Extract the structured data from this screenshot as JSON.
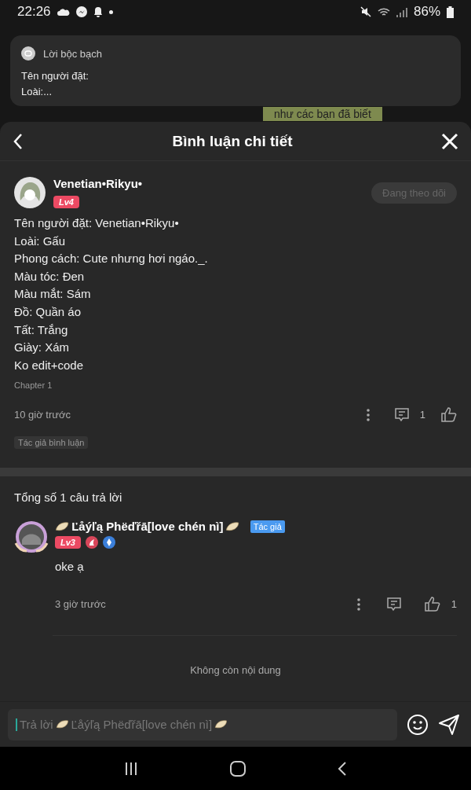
{
  "status_bar": {
    "time": "22:26",
    "battery": "86%"
  },
  "notification": {
    "app": "Lời bộc bạch",
    "lines": [
      "Tên người đặt:",
      "Loài:..."
    ]
  },
  "background_bubble": "như các bạn đã biết",
  "header": {
    "title": "Bình luận chi tiết"
  },
  "comment": {
    "author": "Venetian•Rikyu•",
    "level": "Lv4",
    "follow": "Đang theo dõi",
    "lines": [
      "Tên người đặt: Venetian•Rikyu•",
      "Loài: Gấu",
      "Phong cách: Cute nhưng hơi ngáo._.",
      "Màu tóc: Đen",
      "Màu mắt: Sám",
      "Đồ: Quần áo",
      "Tất: Trắng",
      "Giày: Xám",
      "Ko edit+code"
    ],
    "chapter": "Chapter 1",
    "time": "10 giờ trước",
    "reply_count": "1",
    "tag": "Tác giả bình luận"
  },
  "replies_total": "Tổng số 1 câu trả lời",
  "replies": [
    {
      "author": "Ľåýľą Phëďřā[love chén nì]",
      "author_badge": "Tác giả",
      "level": "Lv3",
      "text": "oke ạ",
      "time": "3 giờ trước",
      "likes": "1"
    }
  ],
  "end_note": "Không còn nội dung",
  "reply_input": {
    "prefix": "Trả lời",
    "target": "Ľåýľą Phëďřā[love chén nì]"
  }
}
